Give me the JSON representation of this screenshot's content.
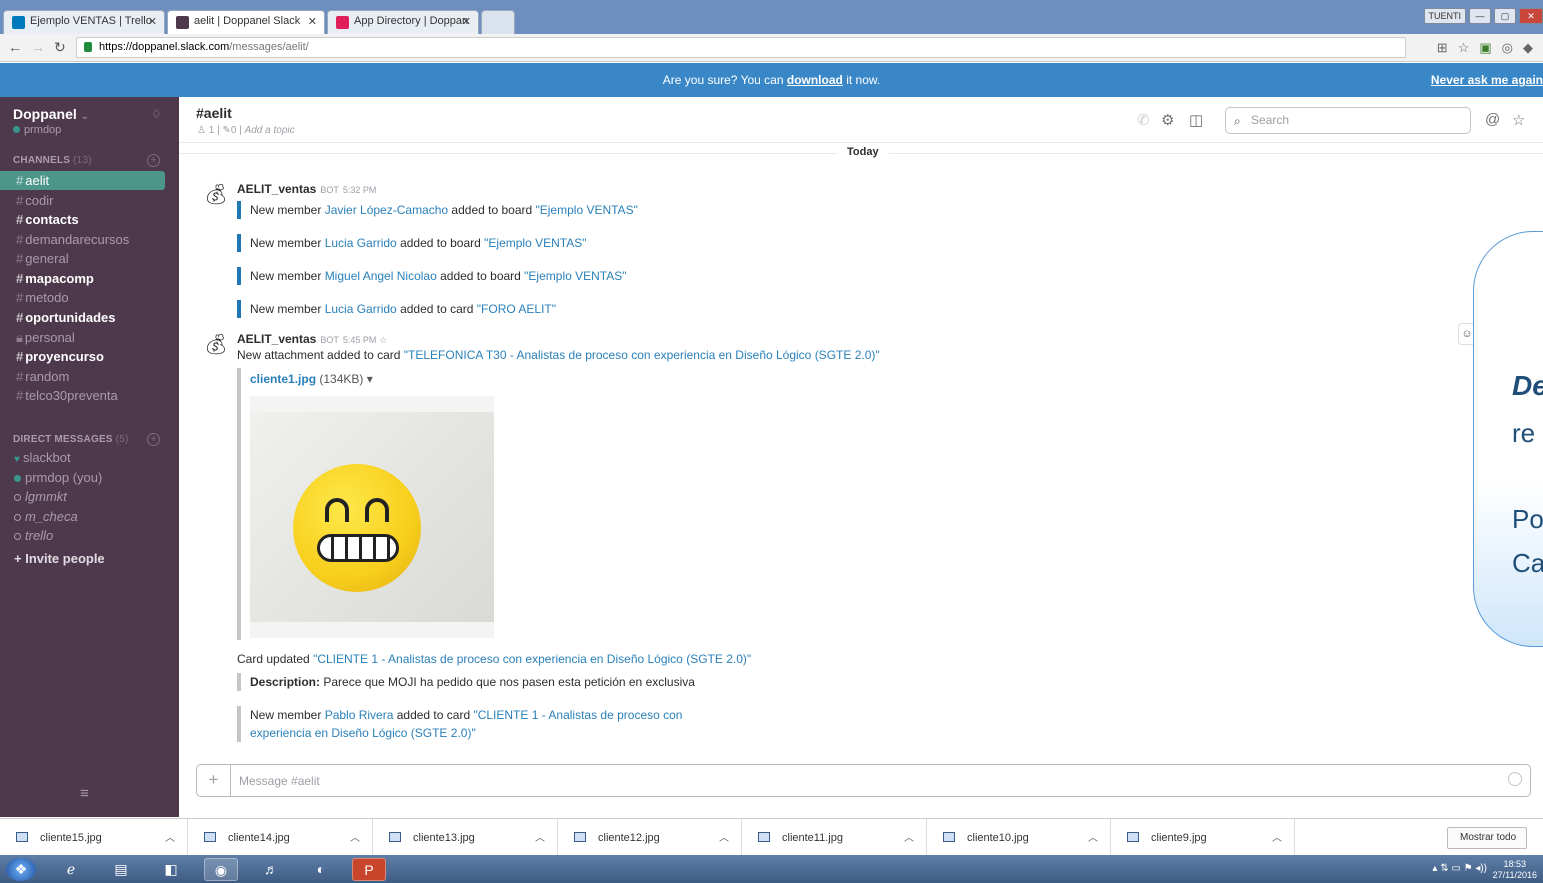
{
  "browser": {
    "tabs": [
      {
        "title": "Ejemplo VENTAS | Trello",
        "favicon_color": "#0079bf"
      },
      {
        "title": "aelit | Doppanel Slack",
        "favicon_color": "#4d394b"
      },
      {
        "title": "App Directory | Doppan",
        "favicon_color": "#e01e5a"
      }
    ],
    "profile_label": "TUENTI",
    "url_host": "https://doppanel.slack.com",
    "url_path": "/messages/aelit/"
  },
  "banner": {
    "text_before": "Are you sure? You can ",
    "link": "download",
    "text_after": " it now.",
    "never_ask": "Never ask me again"
  },
  "sidebar": {
    "team": "Doppanel",
    "user": "prmdop",
    "channels_header": "CHANNELS",
    "channels_count": "(13)",
    "channels": [
      {
        "name": "aelit",
        "state": "active"
      },
      {
        "name": "codir",
        "state": "normal"
      },
      {
        "name": "contacts",
        "state": "unread"
      },
      {
        "name": "demandarecursos",
        "state": "normal"
      },
      {
        "name": "general",
        "state": "normal"
      },
      {
        "name": "mapacomp",
        "state": "unread"
      },
      {
        "name": "metodo",
        "state": "normal"
      },
      {
        "name": "oportunidades",
        "state": "unread"
      },
      {
        "name": "personal",
        "state": "private"
      },
      {
        "name": "proyencurso",
        "state": "unread"
      },
      {
        "name": "random",
        "state": "normal"
      },
      {
        "name": "telco30preventa",
        "state": "normal"
      }
    ],
    "dm_header": "DIRECT MESSAGES",
    "dm_count": "(5)",
    "dms": [
      {
        "name": "slackbot",
        "presence": "heart"
      },
      {
        "name": "prmdop (you)",
        "presence": "online"
      },
      {
        "name": "lgmmkt",
        "presence": "offline"
      },
      {
        "name": "m_checa",
        "presence": "offline"
      },
      {
        "name": "trello",
        "presence": "offline"
      }
    ],
    "invite": "+ Invite people"
  },
  "channel": {
    "name": "#aelit",
    "members": "1",
    "pins": "0",
    "topic_placeholder": "Add a topic",
    "search_placeholder": "Search"
  },
  "messages": {
    "day": "Today",
    "m1": {
      "author": "AELIT_ventas",
      "bot": "BOT",
      "time": "5:32 PM",
      "lines": [
        {
          "pre": "New member ",
          "who": "Javier López-Camacho",
          "mid": " added to board ",
          "target": "\"Ejemplo VENTAS\""
        },
        {
          "pre": "New member ",
          "who": "Lucia Garrido",
          "mid": " added to board ",
          "target": "\"Ejemplo VENTAS\""
        },
        {
          "pre": "New member ",
          "who": "Miguel Angel Nicolao",
          "mid": " added to board ",
          "target": "\"Ejemplo VENTAS\""
        },
        {
          "pre": "New member ",
          "who": "Lucia Garrido",
          "mid": " added to card ",
          "target": "\"FORO AELIT\""
        }
      ]
    },
    "m2": {
      "author": "AELIT_ventas",
      "bot": "BOT",
      "time": "5:45 PM",
      "text_pre": "New attachment added to card ",
      "card_link": "\"TELEFONICA T30 - Analistas de proceso con experiencia en Diseño Lógico (SGTE 2.0)\"",
      "file_name": "cliente1.jpg",
      "file_size": "(134KB) ▾"
    },
    "m3": {
      "text_pre": "Card updated ",
      "card_link": "\"CLIENTE 1 - Analistas de proceso con experiencia en Diseño Lógico (SGTE 2.0)\"",
      "desc_label": "Description:",
      "desc_text": " Parece que MOJI ha pedido que nos pasen esta petición en exclusiva",
      "member_pre": "New member ",
      "member_who": "Pablo Rivera",
      "member_mid": " added to card ",
      "member_target_1": "\"CLIENTE 1 - Analistas de proceso con",
      "member_target_2": "experiencia en Diseño Lógico (SGTE 2.0)\""
    }
  },
  "composer": {
    "placeholder": "Message #aelit"
  },
  "overlay": {
    "t1": "De",
    "t2": "re",
    "t3": "Po",
    "t4": "Ca"
  },
  "downloads": {
    "files": [
      "cliente15.jpg",
      "cliente14.jpg",
      "cliente13.jpg",
      "cliente12.jpg",
      "cliente11.jpg",
      "cliente10.jpg",
      "cliente9.jpg"
    ],
    "show_all": "Mostrar todo"
  },
  "taskbar": {
    "time": "18:53",
    "date": "27/11/2016"
  }
}
